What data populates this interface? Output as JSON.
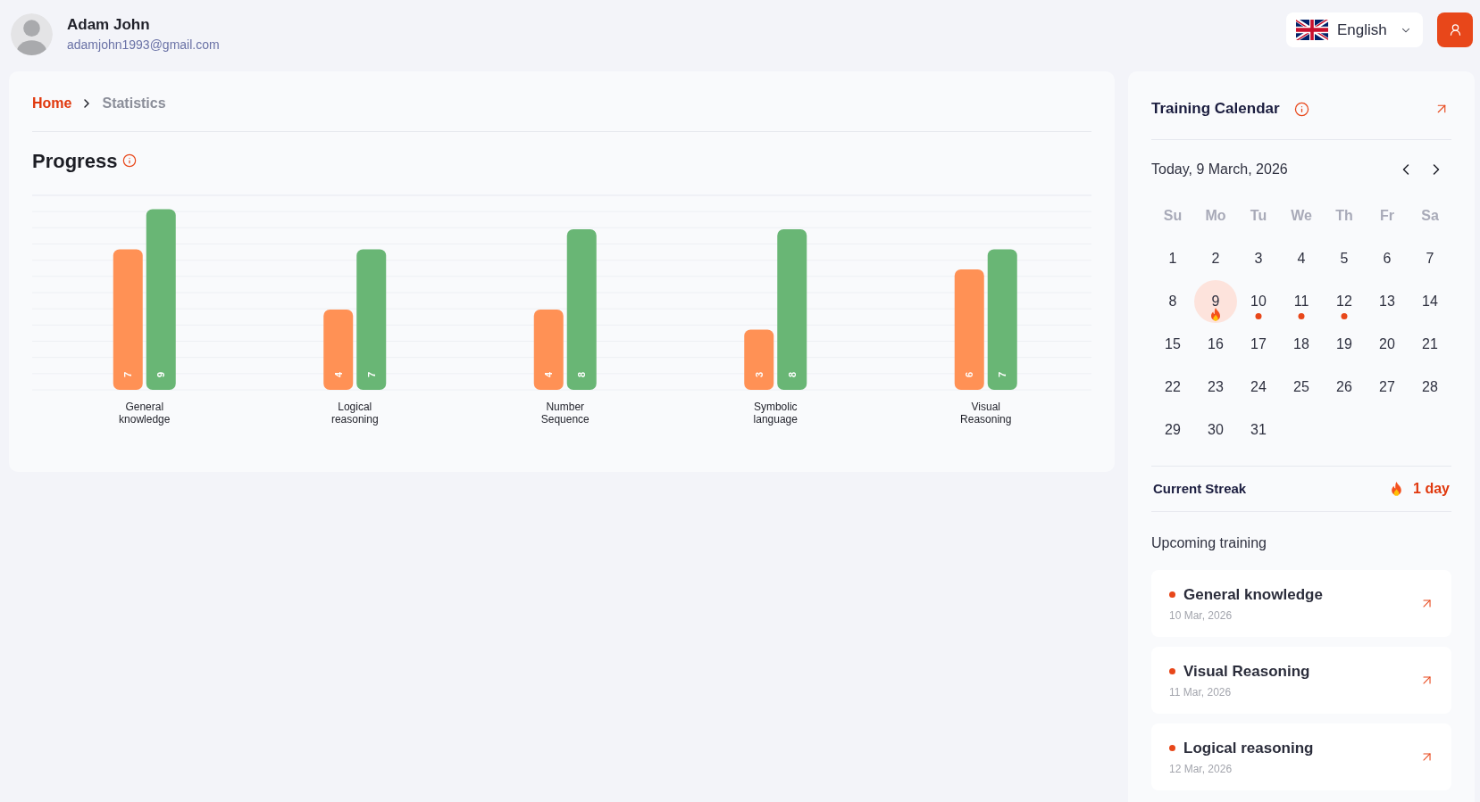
{
  "header": {
    "user": {
      "name": "Adam John",
      "email": "adamjohn1993@gmail.com"
    },
    "language": {
      "label": "English"
    }
  },
  "breadcrumb": [
    {
      "label": "Home",
      "current": false
    },
    {
      "label": "Statistics",
      "current": true
    }
  ],
  "progress": {
    "title": "Progress",
    "chart_data": {
      "type": "bar",
      "categories": [
        "General knowledge",
        "Logical reasoning",
        "Number Sequence",
        "Symbolic language",
        "Visual Reasoning"
      ],
      "series": [
        {
          "color": "#ff9155",
          "values": [
            7,
            4,
            4,
            3,
            6
          ]
        },
        {
          "color": "#69b675",
          "values": [
            9,
            7,
            8,
            8,
            7
          ]
        }
      ],
      "data_labels": true
    }
  },
  "calendar": {
    "title": "Training Calendar",
    "date_label": "Today, 9 March, 2026",
    "weekdays": [
      "Su",
      "Mo",
      "Tu",
      "We",
      "Th",
      "Fr",
      "Sa"
    ],
    "days": [
      {
        "label": "1",
        "today": false,
        "training": false,
        "streak": false
      },
      {
        "label": "2",
        "today": false,
        "training": false,
        "streak": false
      },
      {
        "label": "3",
        "today": false,
        "training": false,
        "streak": false
      },
      {
        "label": "4",
        "today": false,
        "training": false,
        "streak": false
      },
      {
        "label": "5",
        "today": false,
        "training": false,
        "streak": false
      },
      {
        "label": "6",
        "today": false,
        "training": false,
        "streak": false
      },
      {
        "label": "7",
        "today": false,
        "training": false,
        "streak": false
      },
      {
        "label": "8",
        "today": false,
        "training": false,
        "streak": false
      },
      {
        "label": "9",
        "today": true,
        "training": false,
        "streak": true
      },
      {
        "label": "10",
        "today": false,
        "training": true,
        "streak": false
      },
      {
        "label": "11",
        "today": false,
        "training": true,
        "streak": false
      },
      {
        "label": "12",
        "today": false,
        "training": true,
        "streak": false
      },
      {
        "label": "13",
        "today": false,
        "training": false,
        "streak": false
      },
      {
        "label": "14",
        "today": false,
        "training": false,
        "streak": false
      },
      {
        "label": "15",
        "today": false,
        "training": false,
        "streak": false
      },
      {
        "label": "16",
        "today": false,
        "training": false,
        "streak": false
      },
      {
        "label": "17",
        "today": false,
        "training": false,
        "streak": false
      },
      {
        "label": "18",
        "today": false,
        "training": false,
        "streak": false
      },
      {
        "label": "19",
        "today": false,
        "training": false,
        "streak": false
      },
      {
        "label": "20",
        "today": false,
        "training": false,
        "streak": false
      },
      {
        "label": "21",
        "today": false,
        "training": false,
        "streak": false
      },
      {
        "label": "22",
        "today": false,
        "training": false,
        "streak": false
      },
      {
        "label": "23",
        "today": false,
        "training": false,
        "streak": false
      },
      {
        "label": "24",
        "today": false,
        "training": false,
        "streak": false
      },
      {
        "label": "25",
        "today": false,
        "training": false,
        "streak": false
      },
      {
        "label": "26",
        "today": false,
        "training": false,
        "streak": false
      },
      {
        "label": "27",
        "today": false,
        "training": false,
        "streak": false
      },
      {
        "label": "28",
        "today": false,
        "training": false,
        "streak": false
      },
      {
        "label": "29",
        "today": false,
        "training": false,
        "streak": false
      },
      {
        "label": "30",
        "today": false,
        "training": false,
        "streak": false
      },
      {
        "label": "31",
        "today": false,
        "training": false,
        "streak": false
      }
    ]
  },
  "streak": {
    "label": "Current Streak",
    "value": "1 day"
  },
  "upcoming": {
    "title": "Upcoming training",
    "items": [
      {
        "title": "General knowledge",
        "date": "10 Mar, 2026"
      },
      {
        "title": "Visual Reasoning",
        "date": "11 Mar, 2026"
      },
      {
        "title": "Logical reasoning",
        "date": "12 Mar, 2026"
      }
    ]
  }
}
